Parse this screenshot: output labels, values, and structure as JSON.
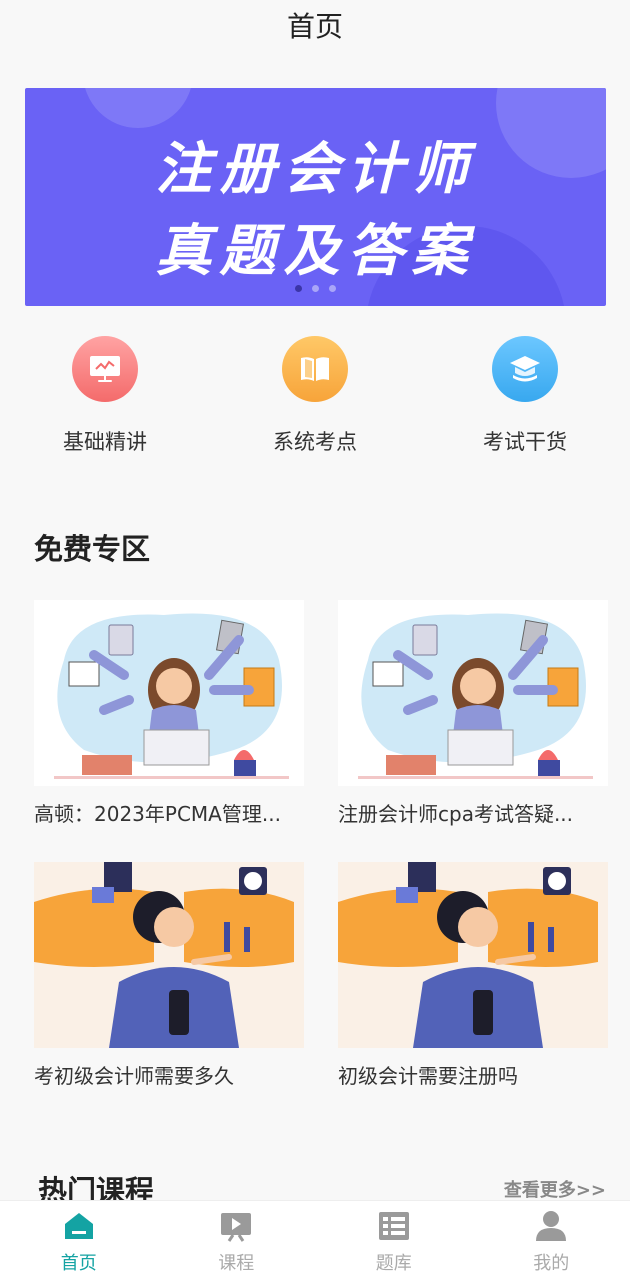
{
  "header": {
    "title": "首页"
  },
  "banner": {
    "line1": "注册会计师",
    "line2": "真题及答案",
    "dots": 3,
    "active_dot": 0,
    "bg_color": "#6a62f5"
  },
  "quick_links": [
    {
      "label": "基础精讲",
      "icon": "presentation-icon",
      "color": "#f46b6b"
    },
    {
      "label": "系统考点",
      "icon": "book-icon",
      "color": "#f7a43a"
    },
    {
      "label": "考试干货",
      "icon": "graduation-cap-icon",
      "color": "#38a8ef"
    }
  ],
  "free_section": {
    "title": "免费专区",
    "cards": [
      {
        "caption": "高顿：2023年PCMA管理...",
        "image": "multitasking-woman-illustration"
      },
      {
        "caption": "注册会计师cpa考试答疑...",
        "image": "multitasking-woman-illustration"
      },
      {
        "caption": "考初级会计师需要多久",
        "image": "woman-with-charts-illustration"
      },
      {
        "caption": "初级会计需要注册吗",
        "image": "woman-with-charts-illustration"
      }
    ]
  },
  "hot_section": {
    "title": "热门课程",
    "more": "查看更多>>"
  },
  "tabbar": {
    "active_color": "#14a3a3",
    "tabs": [
      {
        "label": "首页",
        "icon": "home-icon",
        "active": true
      },
      {
        "label": "课程",
        "icon": "video-icon",
        "active": false
      },
      {
        "label": "题库",
        "icon": "question-bank-icon",
        "active": false
      },
      {
        "label": "我的",
        "icon": "user-icon",
        "active": false
      }
    ]
  }
}
